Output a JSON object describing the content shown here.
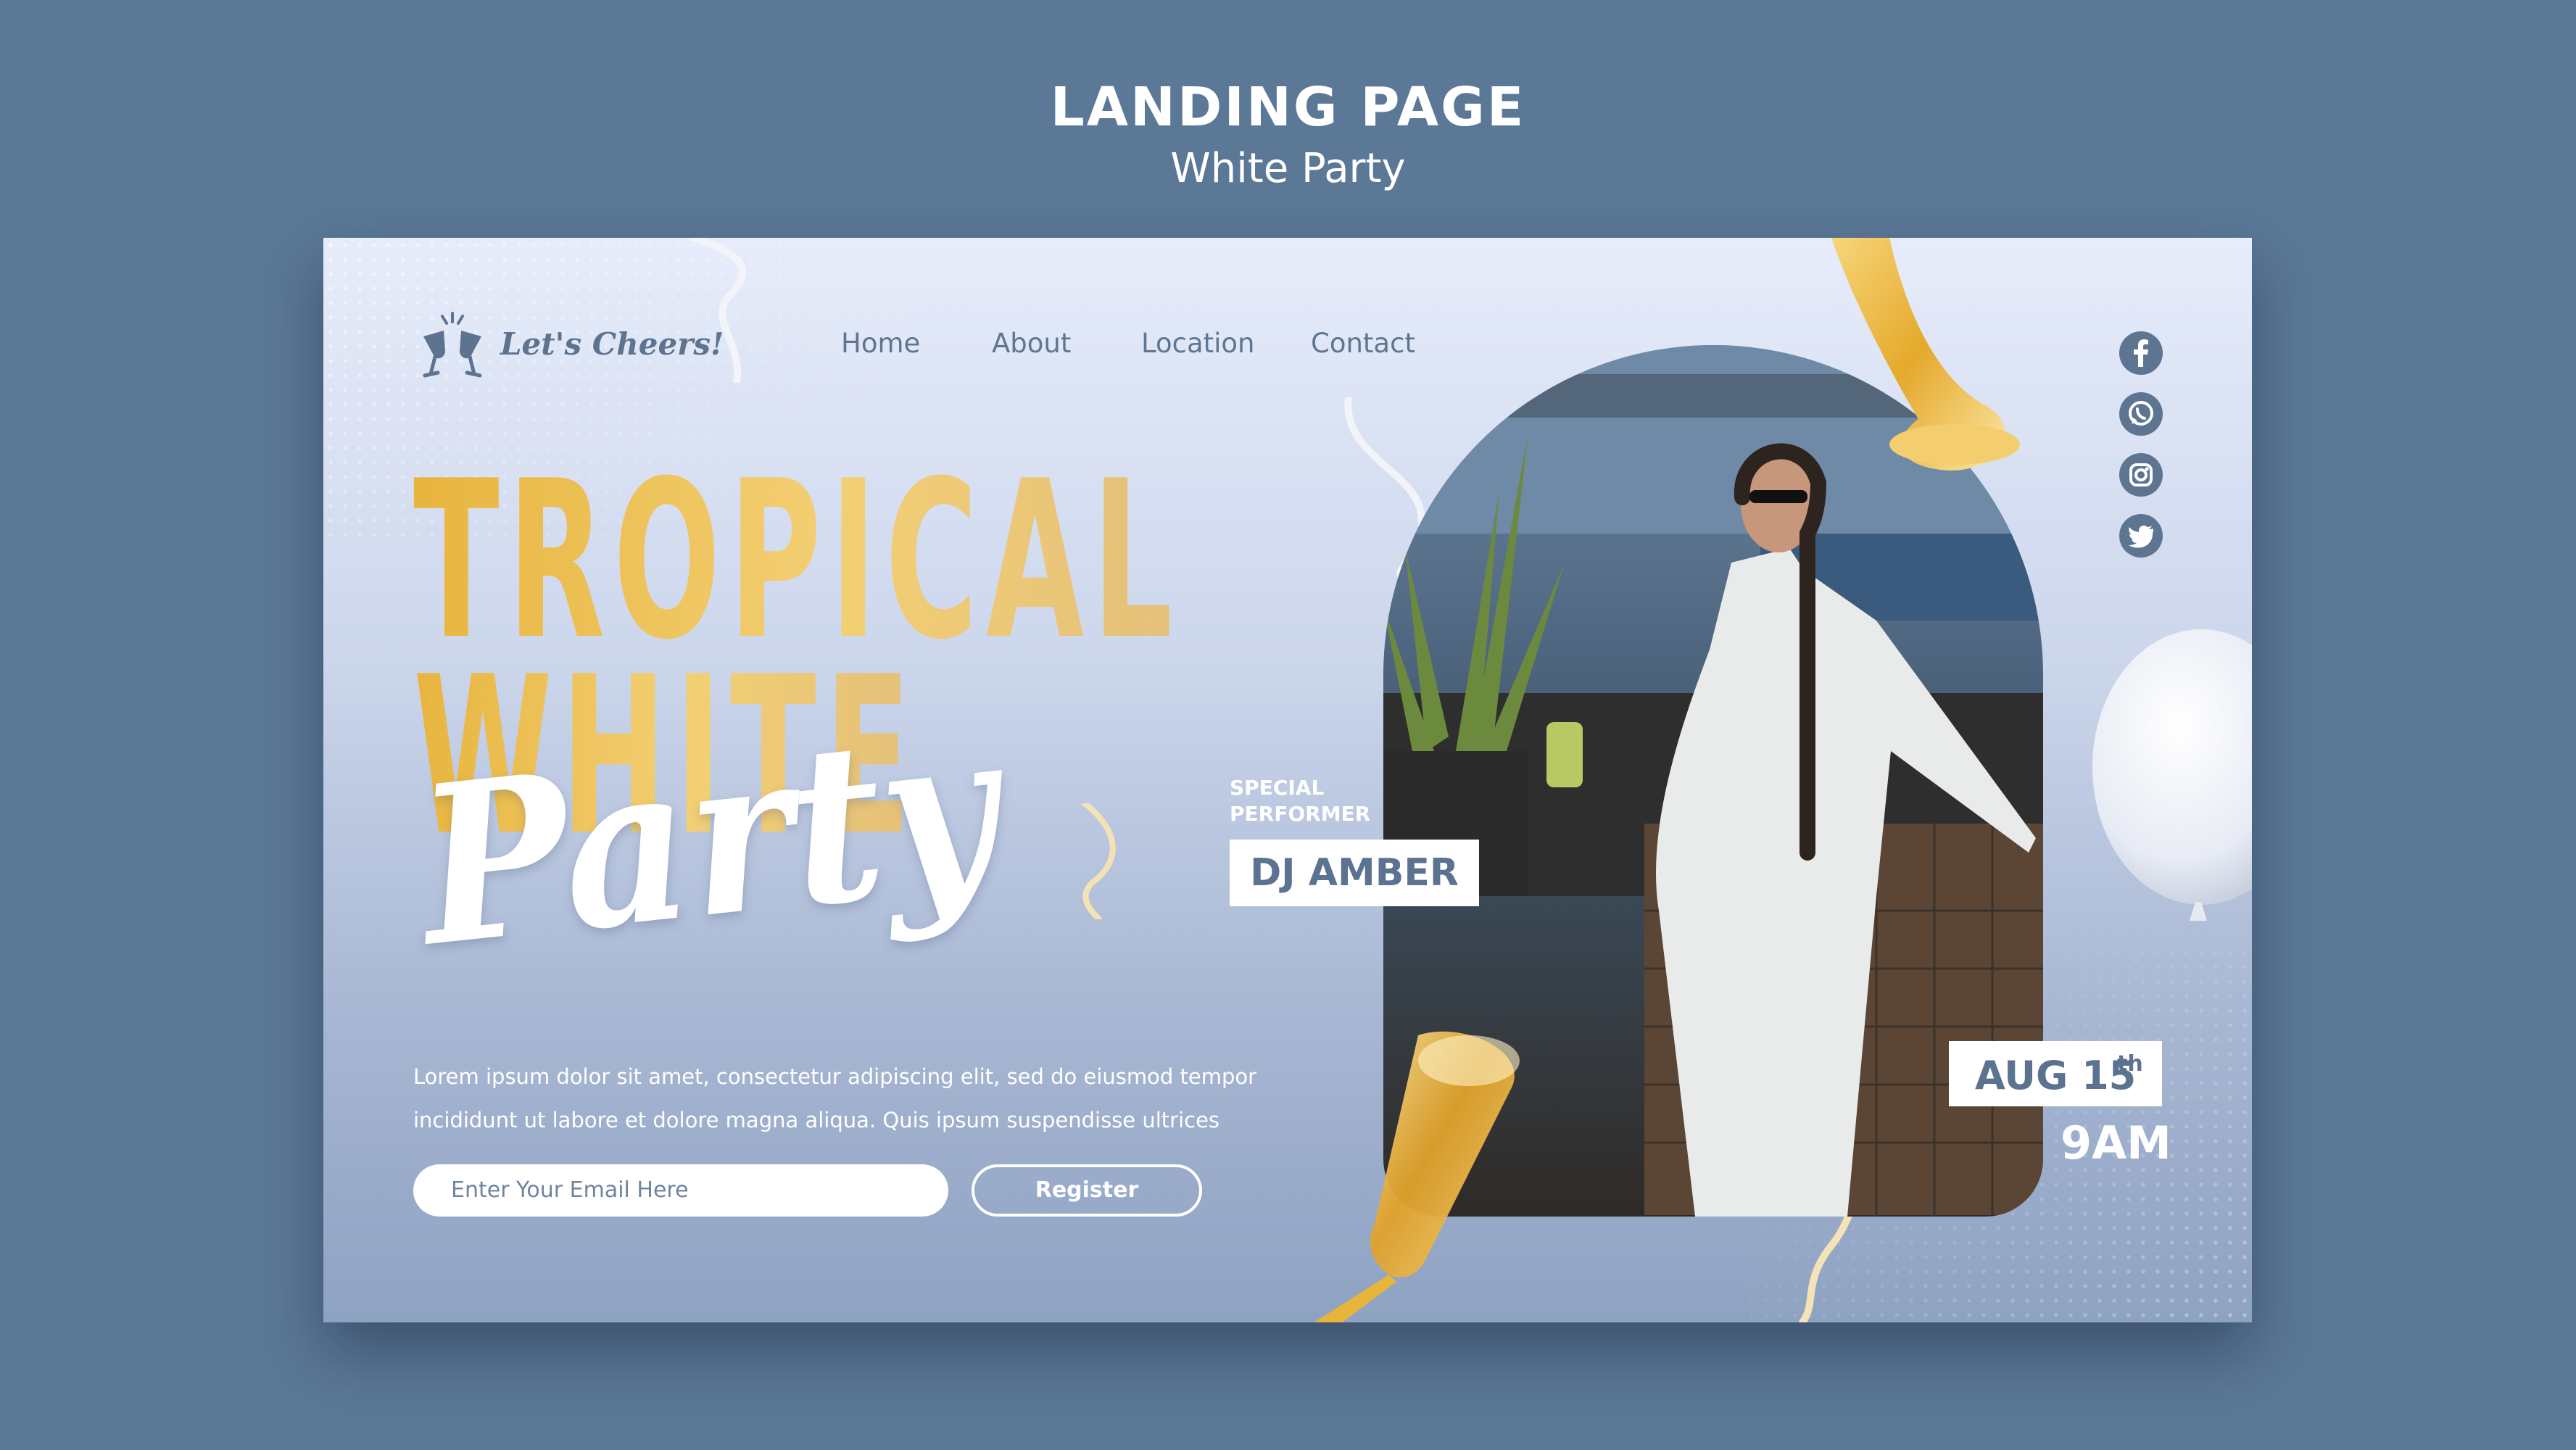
{
  "header": {
    "title": "LANDING PAGE",
    "subtitle": "White Party"
  },
  "logo": {
    "text": "Let's Cheers!",
    "icon": "cheers-glasses-icon"
  },
  "nav": {
    "items": [
      {
        "label": "Home"
      },
      {
        "label": "About"
      },
      {
        "label": "Location"
      },
      {
        "label": "Contact"
      }
    ]
  },
  "social": [
    "facebook-icon",
    "whatsapp-icon",
    "instagram-icon",
    "twitter-icon"
  ],
  "hero": {
    "title_line1": "TROPICAL",
    "title_line2": "WHITE",
    "title_script": "Party",
    "description_line1": "Lorem ipsum dolor sit amet, consectetur adipiscing elit, sed do eiusmod tempor",
    "description_line2": "incididunt ut labore et dolore magna aliqua. Quis ipsum suspendisse ultrices"
  },
  "form": {
    "email_placeholder": "Enter Your Email Here",
    "register_label": "Register"
  },
  "event": {
    "performer_label_line1": "SPECIAL",
    "performer_label_line2": "PERFORMER",
    "performer_name": "DJ AMBER",
    "date": "AUG 15",
    "date_suffix": "th",
    "time": "9AM"
  },
  "colors": {
    "page_bg": "#5b7897",
    "accent_gold": "#e6b546",
    "text_blue": "#5b7291",
    "white": "#ffffff"
  }
}
